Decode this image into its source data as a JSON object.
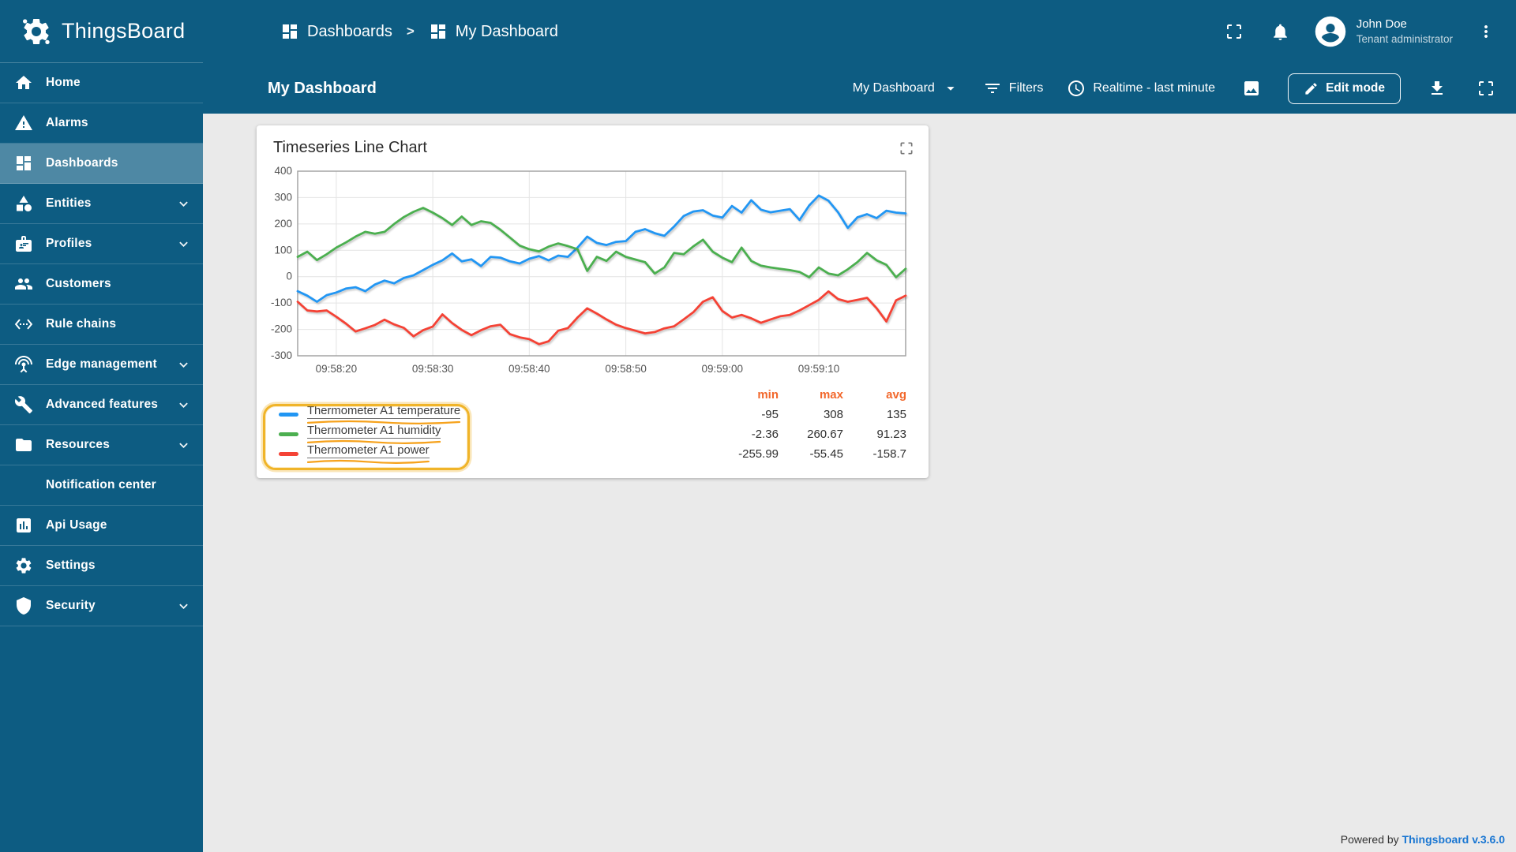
{
  "app": {
    "name": "ThingsBoard"
  },
  "colors": {
    "primary": "#0d5c82",
    "selected": "#4e88a4",
    "content-bg": "#eaeaea",
    "accent": "#f2682c",
    "highlight": "#f0b429",
    "link": "#1976d2"
  },
  "header": {
    "breadcrumb": [
      {
        "label": "Dashboards",
        "icon": "dashboards-icon"
      },
      {
        "label": "My Dashboard",
        "icon": "dashboards-icon"
      }
    ],
    "separator": ">",
    "user": {
      "name": "John Doe",
      "role": "Tenant administrator"
    }
  },
  "toolbar": {
    "title": "My Dashboard",
    "state_selector": "My Dashboard",
    "filters_label": "Filters",
    "timewindow_label": "Realtime - last minute",
    "edit_button": "Edit mode"
  },
  "sidebar": {
    "items": [
      {
        "label": "Home",
        "icon": "home-icon",
        "selected": false,
        "expandable": false
      },
      {
        "label": "Alarms",
        "icon": "warning-icon",
        "selected": false,
        "expandable": false
      },
      {
        "label": "Dashboards",
        "icon": "dashboards-icon",
        "selected": true,
        "expandable": false
      },
      {
        "label": "Entities",
        "icon": "entities-icon",
        "selected": false,
        "expandable": true
      },
      {
        "label": "Profiles",
        "icon": "profiles-icon",
        "selected": false,
        "expandable": true
      },
      {
        "label": "Customers",
        "icon": "customers-icon",
        "selected": false,
        "expandable": false
      },
      {
        "label": "Rule chains",
        "icon": "rule-chains-icon",
        "selected": false,
        "expandable": false
      },
      {
        "label": "Edge management",
        "icon": "edge-management-icon",
        "selected": false,
        "expandable": true
      },
      {
        "label": "Advanced features",
        "icon": "advanced-features-icon",
        "selected": false,
        "expandable": true
      },
      {
        "label": "Resources",
        "icon": "resources-icon",
        "selected": false,
        "expandable": true
      },
      {
        "label": "Notification center",
        "icon": "notification-center-icon",
        "selected": false,
        "expandable": false
      },
      {
        "label": "Api Usage",
        "icon": "api-usage-icon",
        "selected": false,
        "expandable": false
      },
      {
        "label": "Settings",
        "icon": "settings-icon",
        "selected": false,
        "expandable": false
      },
      {
        "label": "Security",
        "icon": "security-icon",
        "selected": false,
        "expandable": true
      }
    ]
  },
  "widget": {
    "title": "Timeseries Line Chart"
  },
  "chart_data": {
    "type": "line",
    "title": "Timeseries Line Chart",
    "x_tick_labels": [
      "09:58:20",
      "09:58:30",
      "09:58:40",
      "09:58:50",
      "09:59:00",
      "09:59:10"
    ],
    "x_tick_indices": [
      4,
      14,
      24,
      34,
      44,
      54
    ],
    "x_interval_seconds": 1,
    "n_points": 64,
    "ylim": [
      -300,
      400
    ],
    "y_tick_step": 100,
    "grid": true,
    "legend_position": "bottom",
    "legend_columns": [
      "min",
      "max",
      "avg"
    ],
    "series": [
      {
        "name": "Thermometer A1 temperature",
        "color": "#2196f3",
        "stats": {
          "min": "-95",
          "max": "308",
          "avg": "135"
        },
        "values": [
          -55,
          -72,
          -95,
          -70,
          -60,
          -45,
          -40,
          -55,
          -30,
          -15,
          -25,
          -5,
          5,
          25,
          45,
          62,
          88,
          58,
          66,
          40,
          75,
          72,
          58,
          50,
          68,
          78,
          62,
          80,
          75,
          110,
          152,
          128,
          120,
          132,
          135,
          170,
          180,
          165,
          155,
          190,
          230,
          247,
          252,
          232,
          224,
          268,
          243,
          290,
          254,
          244,
          250,
          256,
          215,
          270,
          308,
          288,
          244,
          185,
          225,
          237,
          222,
          250,
          243,
          240
        ]
      },
      {
        "name": "Thermometer A1 humidity",
        "color": "#4caf50",
        "stats": {
          "min": "-2.36",
          "max": "260.67",
          "avg": "91.23"
        },
        "values": [
          75,
          95,
          63,
          85,
          110,
          130,
          152,
          170,
          163,
          170,
          200,
          226,
          246,
          261,
          243,
          222,
          196,
          228,
          196,
          210,
          204,
          178,
          148,
          118,
          104,
          96,
          114,
          126,
          116,
          104,
          22,
          75,
          60,
          95,
          75,
          65,
          55,
          12,
          35,
          90,
          85,
          115,
          140,
          95,
          72,
          55,
          110,
          60,
          42,
          35,
          30,
          25,
          18,
          -2,
          35,
          12,
          5,
          28,
          55,
          90,
          62,
          45,
          -2,
          30
        ]
      },
      {
        "name": "Thermometer A1 power",
        "color": "#f44336",
        "stats": {
          "min": "-255.99",
          "max": "-55.45",
          "avg": "-158.7"
        },
        "values": [
          -95,
          -128,
          -132,
          -128,
          -152,
          -178,
          -208,
          -196,
          -183,
          -163,
          -181,
          -194,
          -226,
          -203,
          -189,
          -143,
          -176,
          -202,
          -222,
          -203,
          -188,
          -182,
          -218,
          -230,
          -237,
          -256,
          -245,
          -205,
          -195,
          -155,
          -120,
          -140,
          -162,
          -182,
          -195,
          -205,
          -215,
          -210,
          -196,
          -188,
          -162,
          -135,
          -95,
          -78,
          -130,
          -155,
          -145,
          -158,
          -175,
          -162,
          -150,
          -145,
          -128,
          -108,
          -88,
          -56,
          -85,
          -95,
          -88,
          -80,
          -120,
          -170,
          -90,
          -72
        ]
      }
    ]
  },
  "footer": {
    "powered_by": "Powered by",
    "powered_link": "Thingsboard v.3.6.0"
  }
}
